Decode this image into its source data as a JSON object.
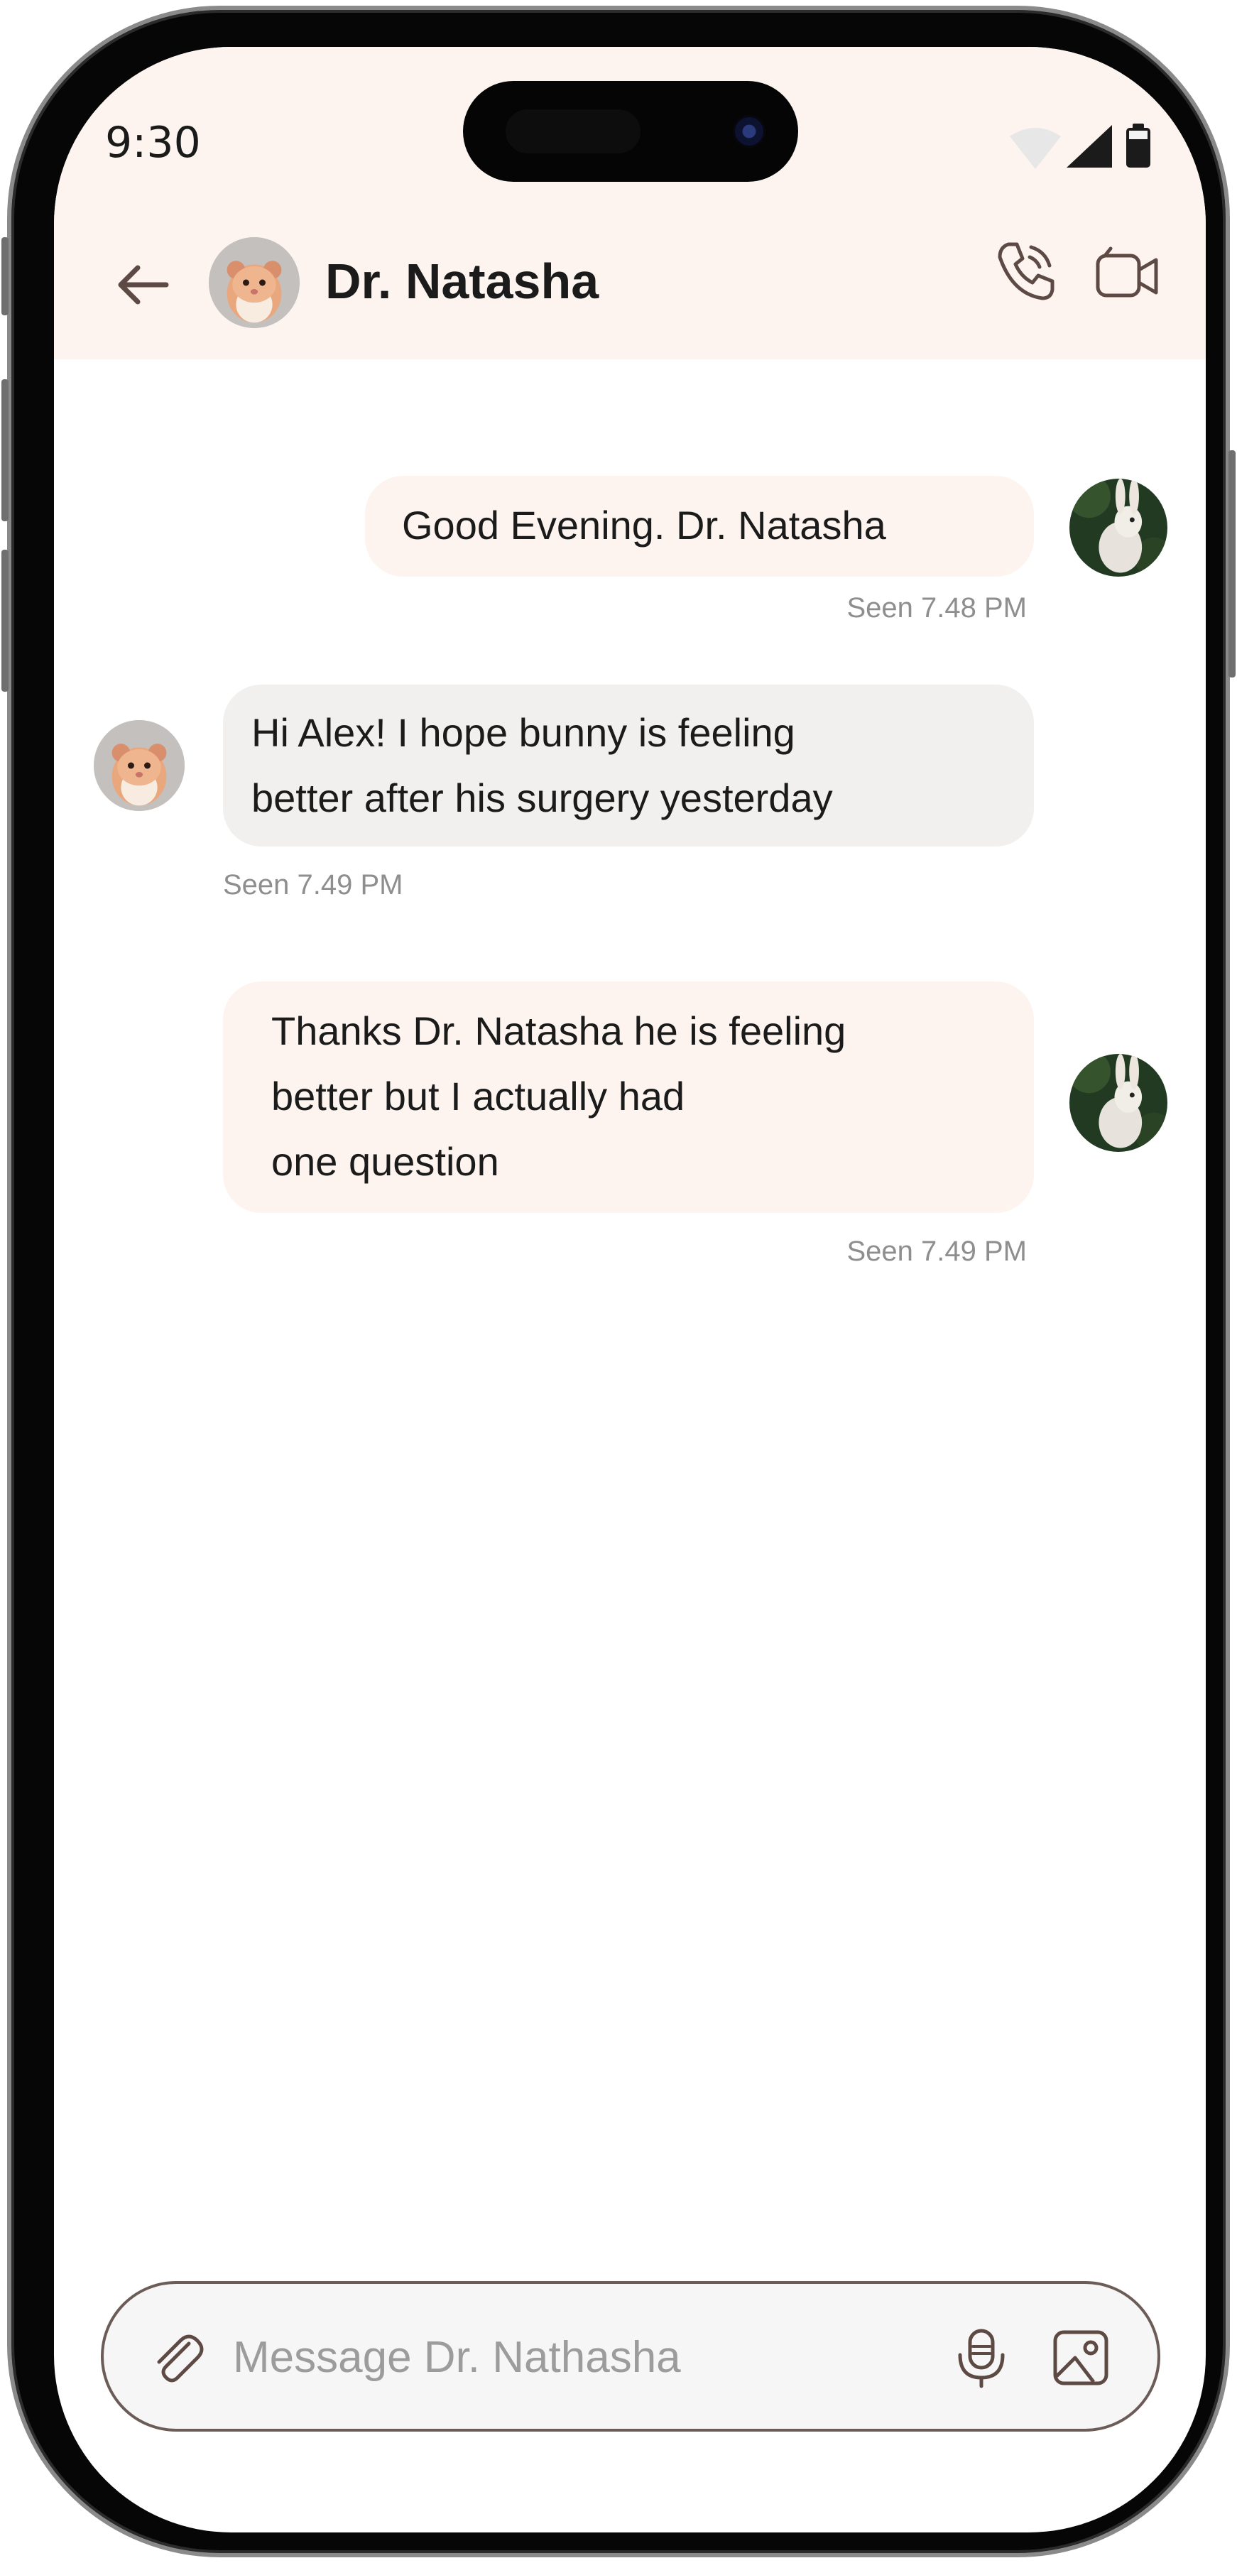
{
  "status_bar": {
    "time": "9:30",
    "icons": [
      "wifi-icon",
      "signal-icon",
      "battery-icon"
    ]
  },
  "header": {
    "back_icon": "back-arrow-icon",
    "contact_name": "Dr. Natasha",
    "contact_avatar": "hamster-avatar",
    "actions": [
      "phone-call-icon",
      "video-call-icon"
    ]
  },
  "messages": [
    {
      "direction": "outgoing",
      "text": "Good Evening. Dr. Natasha",
      "lines": [
        "Good Evening. Dr. Natasha"
      ],
      "seen": "Seen 7.48 PM",
      "avatar": "bunny-avatar"
    },
    {
      "direction": "incoming",
      "text": "Hi Alex! I hope bunny is feeling better after his surgery yesterday",
      "lines": [
        "Hi Alex! I hope bunny is feeling",
        "better after his surgery yesterday"
      ],
      "seen": "Seen 7.49 PM",
      "avatar": "hamster-avatar"
    },
    {
      "direction": "outgoing",
      "text": "Thanks Dr. Natasha he is feeling better but I actually had one question",
      "lines": [
        "Thanks Dr. Natasha he is feeling",
        "better but I actually had",
        "one question"
      ],
      "seen": "Seen 7.49 PM",
      "avatar": "bunny-avatar"
    }
  ],
  "composer": {
    "placeholder": "Message Dr. Nathasha",
    "value": "",
    "icons": [
      "paperclip-icon",
      "microphone-icon",
      "image-icon"
    ]
  },
  "colors": {
    "header_background": "#fdf4ef",
    "outgoing_bubble": "#fdf4ef",
    "incoming_bubble": "#f1f0ef",
    "seen_text": "#8e8e8e",
    "icon_color": "#5e4a45",
    "composer_border": "#6c5c58"
  }
}
